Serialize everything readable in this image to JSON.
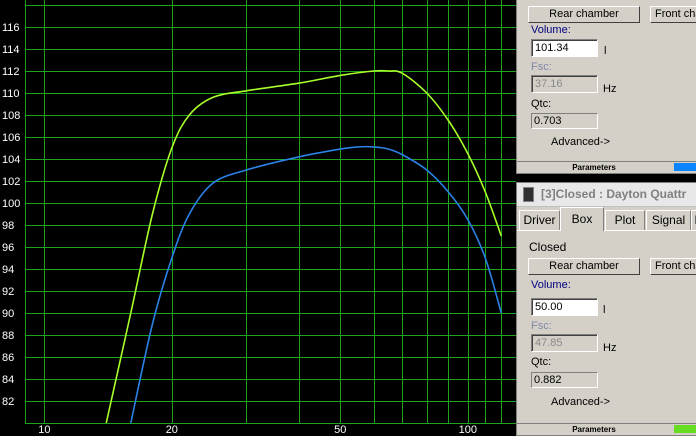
{
  "plot": {
    "y_ticks": [
      "116",
      "114",
      "112",
      "110",
      "108",
      "106",
      "104",
      "102",
      "100",
      "98",
      "96",
      "94",
      "92",
      "90",
      "88",
      "86",
      "84",
      "82"
    ],
    "x_ticks": [
      "10",
      "20",
      "50",
      "100"
    ],
    "colors": {
      "grid": "#1fa31f",
      "curve1": "#a8ff2a",
      "curve2": "#2a82e6",
      "text": "#ffffff"
    }
  },
  "chart_data": {
    "type": "line",
    "xscale": "log",
    "xlim": [
      9,
      130
    ],
    "ylim": [
      80,
      118
    ],
    "series": [
      {
        "x": [
          14,
          16,
          18,
          20,
          22,
          25,
          30,
          40,
          50,
          60,
          65,
          70,
          80,
          90,
          100,
          110,
          120
        ],
        "y": [
          80,
          90,
          99,
          105,
          108,
          109.6,
          110.2,
          110.9,
          111.6,
          112,
          112,
          111.8,
          110,
          107.5,
          104.5,
          101,
          97
        ]
      },
      {
        "x": [
          16,
          18,
          20,
          22,
          25,
          30,
          40,
          50,
          55,
          60,
          65,
          70,
          80,
          90,
          100,
          110,
          120
        ],
        "y": [
          80,
          89,
          95,
          99,
          101.8,
          103,
          104.2,
          104.9,
          105.1,
          105.1,
          104.9,
          104.4,
          103,
          101,
          98.5,
          95,
          90
        ]
      }
    ]
  },
  "panel_top": {
    "rear_btn": "Rear chamber",
    "front_btn": "Front cha",
    "volume_label": "Volume:",
    "volume_value": "101.34",
    "volume_unit": "l",
    "fsc_label": "Fsc:",
    "fsc_value": "37.16",
    "fsc_unit": "Hz",
    "qtc_label": "Qtc:",
    "qtc_value": "0.703",
    "advanced": "Advanced->",
    "status": "Parameters",
    "status_color": "#0a84ff"
  },
  "panel_bottom": {
    "title": "[3]Closed : Dayton Quattr",
    "tabs": [
      "Driver",
      "Box",
      "Plot",
      "Signal",
      "I"
    ],
    "active_tab": "Box",
    "box_type": "Closed",
    "rear_btn": "Rear chamber",
    "front_btn": "Front cha",
    "volume_label": "Volume:",
    "volume_value": "50.00",
    "volume_unit": "l",
    "fsc_label": "Fsc:",
    "fsc_value": "47.85",
    "fsc_unit": "Hz",
    "qtc_label": "Qtc:",
    "qtc_value": "0.882",
    "advanced": "Advanced->",
    "status": "Parameters",
    "status_color": "#66dd22"
  }
}
